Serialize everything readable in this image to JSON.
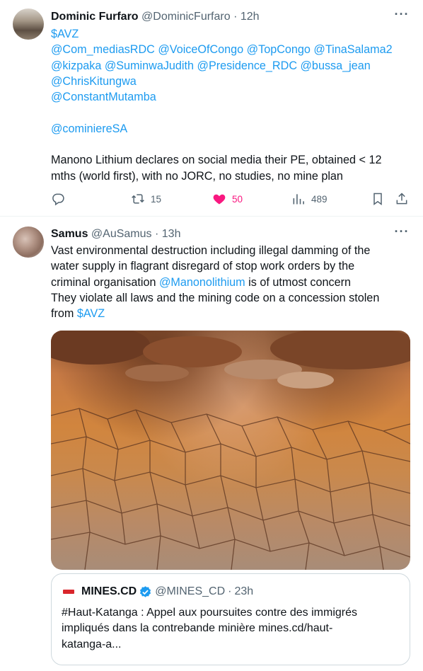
{
  "tweets": [
    {
      "author_name": "Dominic Furfaro",
      "author_handle": "@DominicFurfaro",
      "separator": "·",
      "time": "12h",
      "more_label": "···",
      "lines": [
        "$AVZ",
        "@Com_mediasRDC @VoiceOfCongo @TopCongo @TinaSalama2",
        "@kizpaka @SuminwaJudith @Presidence_RDC @bussa_jean",
        "@ChrisKitungwa",
        "@ConstantMutamba",
        "",
        "@cominiereSA",
        "",
        "Manono Lithium declares on social media their PE, obtained < 12",
        "mths (world first), with no JORC, no studies, no mine plan"
      ],
      "actions": {
        "reply_count": "",
        "retweet_count": "15",
        "like_count": "50",
        "views_count": "489"
      },
      "like_color": "#f91880"
    },
    {
      "author_name": "Samus",
      "author_handle": "@AuSamus",
      "separator": "·",
      "time": "13h",
      "more_label": "···",
      "text": {
        "line1": "Vast environmental destruction including illegal damming of the",
        "line2": "water supply in flagrant disregard of stop work orders by the",
        "line3_pre": "criminal organisation ",
        "line3_mention": "@Manonolithium",
        "line3_post": " is of utmost concern",
        "line4": "They violate all laws and the mining code on a concession stolen",
        "line5_pre": "from ",
        "line5_cashtag": "$AVZ"
      },
      "media": {
        "description_icon": "photo"
      },
      "quote": {
        "name": "MINES.CD",
        "handle": "@MINES_CD",
        "separator": "·",
        "time": "23h",
        "lines": [
          "#Haut-Katanga : Appel aux poursuites contre des immigrés",
          "impliqués dans la contrebande minière mines.cd/haut-",
          "katanga-a..."
        ]
      }
    }
  ],
  "colors": {
    "link": "#1d9bf0",
    "secondary_text": "#536471",
    "like": "#f91880",
    "verified": "#1d9bf0"
  }
}
